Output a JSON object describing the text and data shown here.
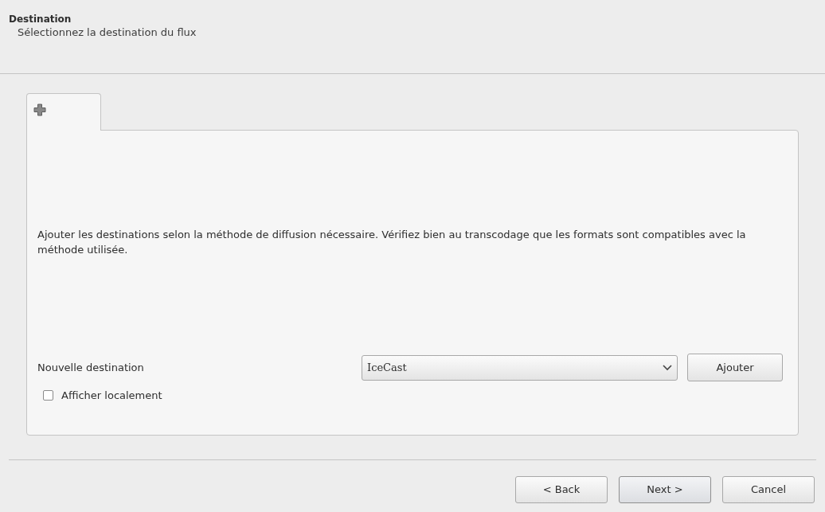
{
  "header": {
    "title": "Destination",
    "subtitle": "Sélectionnez la destination du flux"
  },
  "tabs": [
    {
      "kind": "add",
      "selected": true
    }
  ],
  "panel": {
    "description": "Ajouter les destinations selon la méthode de diffusion nécessaire. Vérifiez bien au transcodage que les formats sont compatibles avec la méthode utilisée.",
    "new_destination_label": "Nouvelle destination",
    "method": "IceCast",
    "add_button": "Ajouter",
    "show_locally": {
      "label": "Afficher localement",
      "checked": false
    }
  },
  "buttons": [
    {
      "label": "< Back",
      "default": false
    },
    {
      "label": "Next >",
      "default": true
    },
    {
      "label": "Cancel",
      "default": false
    }
  ]
}
